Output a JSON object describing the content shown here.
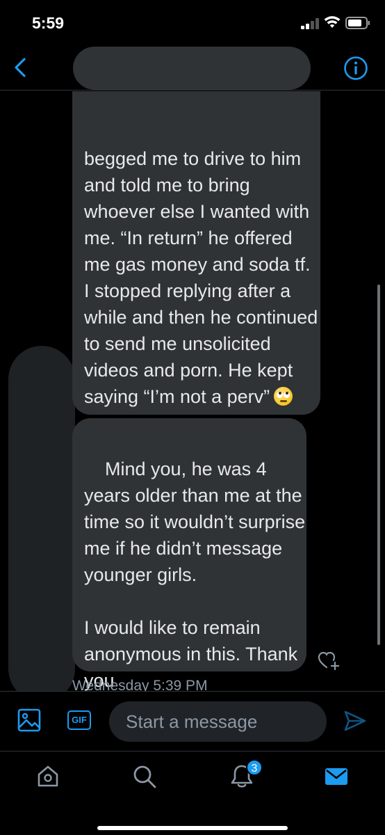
{
  "status_bar": {
    "time": "5:59"
  },
  "header": {
    "back_icon": "chevron-left-icon",
    "info_icon": "info-circle-icon",
    "accent": "#1d9bf0"
  },
  "messages": [
    {
      "text": "begged me to drive to him and told me to bring whoever else I wanted with me. “In return” he offered me gas money and soda tf. I stopped replying after a while and then he continued to send me unsolicited videos and porn. He kept saying “I’m not a perv”",
      "emoji": "face-with-rolling-eyes"
    },
    {
      "text": "Mind you, he was 4 years older than me at the time so it wouldn’t surprise me if he didn’t message younger girls.\n\nI would like to remain anonymous in this. Thank you"
    }
  ],
  "timestamp": "Wednesday 5:39 PM",
  "composer": {
    "placeholder": "Start a message",
    "gif_label": "GIF",
    "image_icon": "image-icon",
    "send_icon": "send-icon"
  },
  "tabbar": {
    "tabs": [
      "home-icon",
      "search-icon",
      "notifications-icon",
      "messages-icon"
    ],
    "notification_count": "3"
  },
  "colors": {
    "bubble": "#2f3336",
    "background": "#000000",
    "accent": "#1d9bf0",
    "muted": "#8b98a5"
  }
}
